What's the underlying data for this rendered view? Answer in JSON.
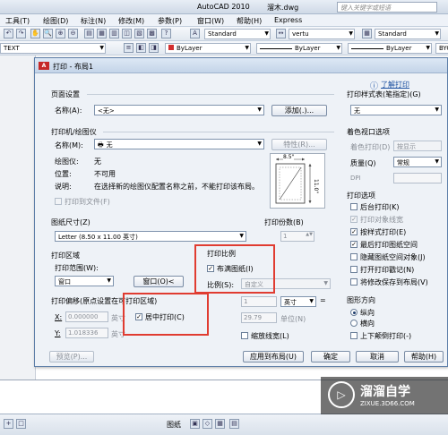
{
  "app": {
    "title": "AutoCAD 2010",
    "file": "溜木.dwg",
    "search_placeholder": "键入关键字或短语"
  },
  "menu": [
    "工具(T)",
    "绘图(D)",
    "标注(N)",
    "修改(M)",
    "参数(P)",
    "窗口(W)",
    "帮助(H)",
    "Express"
  ],
  "toolbar1": {
    "style1": "Standard",
    "style2": "vertu",
    "style3": "Standard"
  },
  "toolbar2": {
    "textstyle": "TEXT",
    "color": "ByLayer",
    "linetype": "ByLayer",
    "lineweight": "ByLayer",
    "plotstyle": "BYC"
  },
  "dialog": {
    "title": "打印 - 布局1",
    "help_link": "了解打印",
    "page_setup": {
      "heading": "页面设置",
      "name_label": "名称(A):",
      "name_value": "<无>",
      "add_button": "添加(.)..."
    },
    "printer": {
      "heading": "打印机/绘图仪",
      "name_label": "名称(M):",
      "name_value": "无",
      "properties_button": "特性(R)...",
      "plotter_label": "绘图仪:",
      "plotter_value": "无",
      "location_label": "位置:",
      "location_value": "不可用",
      "desc_label": "说明:",
      "desc_value": "在选择新的绘图仪配置名称之前，不能打印该布局。",
      "print_to_file": "打印到文件(F)"
    },
    "preview": {
      "width_label": "8.5\"",
      "height_label": "11.0\""
    },
    "paper_size": {
      "heading": "图纸尺寸(Z)",
      "value": "Letter (8.50 x 11.00 英寸)"
    },
    "copies": {
      "heading": "打印份数(B)",
      "value": "1"
    },
    "plot_area": {
      "heading": "打印区域",
      "range_label": "打印范围(W):",
      "range_value": "窗口",
      "window_button": "窗口(O)<"
    },
    "plot_scale": {
      "heading": "打印比例",
      "fit_paper": "布满图纸(I)",
      "scale_label": "比例(S):",
      "scale_value": "自定义",
      "value1": "1",
      "unit1": "英寸",
      "value2": "29.79",
      "unit2": "单位(N)",
      "scale_lineweights": "缩放线宽(L)"
    },
    "plot_offset": {
      "heading": "打印偏移(原点设置在可打印区域)",
      "x_label": "X:",
      "x_value": "0.000000",
      "x_unit": "英寸",
      "y_label": "Y:",
      "y_value": "1.018336",
      "y_unit": "英寸",
      "center": "居中打印(C)"
    },
    "plot_style_table": {
      "heading": "打印样式表(笔指定)(G)",
      "value": "无"
    },
    "shaded_viewport": {
      "heading": "着色视口选项",
      "shade_label": "着色打印(D)",
      "shade_value": "按显示",
      "quality_label": "质量(Q)",
      "quality_value": "常规",
      "dpi_label": "DPI"
    },
    "plot_options": {
      "heading": "打印选项",
      "items": [
        "后台打印(K)",
        "打印对象线宽",
        "按样式打印(E)",
        "最后打印图纸空间",
        "隐藏图纸空间对象(J)",
        "打开打印戳记(N)",
        "将修改保存到布局(V)"
      ]
    },
    "orientation": {
      "heading": "图形方向",
      "portrait": "纵向",
      "landscape": "横向",
      "upside_down": "上下颠倒打印(-)"
    },
    "buttons": {
      "preview": "预览(P)...",
      "apply": "应用到布局(U)",
      "ok": "确定",
      "cancel": "取消",
      "help": "帮助(H)"
    }
  },
  "statusbar": {
    "paper": "图纸"
  },
  "watermark": {
    "title": "溜溜自学",
    "subtitle": "ZIXUE.3D66.COM"
  },
  "colors": {
    "highlight": "#e03c31",
    "dialog_bg": "#eef2f7"
  }
}
